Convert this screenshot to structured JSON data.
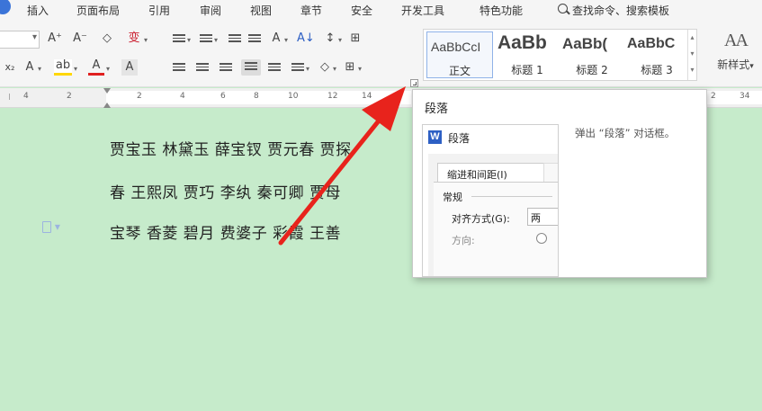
{
  "menu": {
    "items": [
      "插入",
      "页面布局",
      "引用",
      "审阅",
      "视图",
      "章节",
      "安全",
      "开发工具",
      "特色功能"
    ],
    "search_label": "查找命令、搜索模板"
  },
  "toolbar": {
    "grow_font": "A⁺",
    "shrink_font": "A⁻",
    "clear_format": "◇",
    "phonetic": "变",
    "font_color_a": "A",
    "highlight": "ab",
    "font_color": "A",
    "char_shade": "A",
    "text_effect": "A",
    "sort": "A↓",
    "line_spacing": "↕",
    "border": "⊞"
  },
  "styles": {
    "items": [
      {
        "sample": "AaBbCcI",
        "label": "正文"
      },
      {
        "sample": "AaBb",
        "label": "标题 1"
      },
      {
        "sample": "AaBb(",
        "label": "标题 2"
      },
      {
        "sample": "AaBbC",
        "label": "标题 3"
      }
    ],
    "new_style_icon": "AA",
    "new_style_label": "新样式"
  },
  "ruler": {
    "numbers": [
      "4",
      "2",
      "2",
      "4",
      "6",
      "8",
      "10",
      "12",
      "14",
      "2",
      "34"
    ]
  },
  "document": {
    "lines": [
      "贾宝玉  林黛玉  薛宝钗  贾元春  贾探",
      "春  王熙凤  贾巧  李纨  秦可卿  贾母",
      "宝琴  香菱    碧月  费婆子  彩霞  王善"
    ]
  },
  "tooltip": {
    "title": "段落",
    "description": "弹出 “段落” 对话框。",
    "preview": {
      "dialog_title": "段落",
      "tab_label": "缩进和间距(I)",
      "section": "常规",
      "align_label": "对齐方式(G):",
      "align_value": "两",
      "direction_label": "方向:"
    }
  },
  "colors": {
    "doc_background": "#c6ebcb",
    "arrow": "#e8231c",
    "wps_blue": "#2d5fc4"
  }
}
